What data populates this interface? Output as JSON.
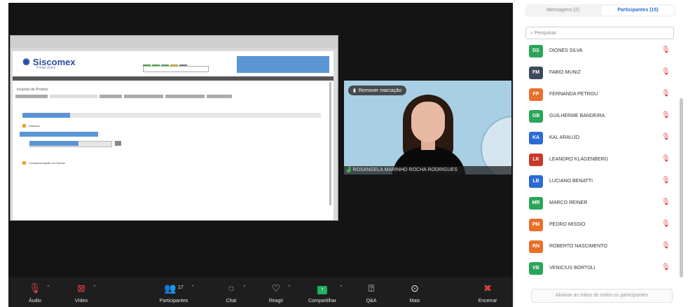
{
  "shared_screen": {
    "app_name": "Siscomex",
    "app_subtitle": "Portal Único",
    "page_title": "Inclusão de Produto",
    "section_1": "Atributos",
    "section_2": "Complementação do Produto",
    "colors": {
      "header_blue": "#5b95d6",
      "accent_orange": "#f0a030",
      "bar_blue": "#5b95d6"
    }
  },
  "video": {
    "remove_pin_label": "Remover marcação",
    "participant_name": "ROSANGELA MARINHO ROCHA RODRIGUES",
    "icon_pin": "pin-icon",
    "icon_signal": "signal-icon"
  },
  "toolbar": {
    "audio": "Áudio",
    "video": "Vídeo",
    "participants": "Participantes",
    "participants_count": "17",
    "chat": "Chat",
    "react": "Reagir",
    "share": "Compartilhar",
    "qa": "Q&A",
    "more": "Mais",
    "end": "Encerrar"
  },
  "panel": {
    "tab_messages": "Mensagens (2)",
    "tab_participants": "Participantes (15)",
    "search_placeholder": "Pesquisar",
    "lower_all": "Abaixar as mãos de todos os participantes",
    "participants": [
      {
        "initials": "DS",
        "name": "DIONES SILVA",
        "color": "#2aa55a"
      },
      {
        "initials": "FM",
        "name": "FABIO MUNIZ",
        "color": "#3d4a5c"
      },
      {
        "initials": "FP",
        "name": "FERNANDA PETROU",
        "color": "#e8702a"
      },
      {
        "initials": "GB",
        "name": "GUILHERME BANDEIRA",
        "color": "#2aa55a"
      },
      {
        "initials": "KA",
        "name": "KAL ARAUJO",
        "color": "#2b6bd6"
      },
      {
        "initials": "LK",
        "name": "LEANDRO KLAGENBERG",
        "color": "#c83a2a"
      },
      {
        "initials": "LB",
        "name": "LUCIANO BENATTI",
        "color": "#2b6bd6"
      },
      {
        "initials": "MR",
        "name": "MARCO REINER",
        "color": "#2aa55a"
      },
      {
        "initials": "PM",
        "name": "PEDRO MISSIO",
        "color": "#e8702a"
      },
      {
        "initials": "RN",
        "name": "ROBERTO NASCIMENTO",
        "color": "#e8702a"
      },
      {
        "initials": "VB",
        "name": "VENICIUS BORTOLI",
        "color": "#2aa55a"
      }
    ]
  }
}
